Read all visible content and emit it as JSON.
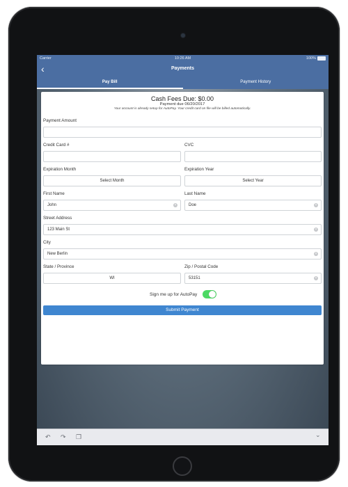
{
  "status_bar": {
    "carrier": "Carrier",
    "time": "10:26 AM",
    "battery": "100%"
  },
  "nav": {
    "title": "Payments",
    "back_icon": "‹"
  },
  "tabs": [
    {
      "label": "Pay Bill",
      "active": true
    },
    {
      "label": "Payment History",
      "active": false
    }
  ],
  "header": {
    "title": "Cash Fees Due: $0.00",
    "due": "Payment due 06/20/2017",
    "note": "Your account is already setup for AutoPay. Your credit card on file will be billed automatically."
  },
  "form": {
    "payment_amount": {
      "label": "Payment Amount",
      "value": ""
    },
    "credit_card": {
      "label": "Credit Card #",
      "value": ""
    },
    "cvc": {
      "label": "CVC",
      "value": ""
    },
    "exp_month": {
      "label": "Expiration Month",
      "value": "Select Month"
    },
    "exp_year": {
      "label": "Expiration Year",
      "value": "Select Year"
    },
    "first_name": {
      "label": "First Name",
      "value": "John"
    },
    "last_name": {
      "label": "Last Name",
      "value": "Doe"
    },
    "street": {
      "label": "Street Address",
      "value": "123 Main St"
    },
    "city": {
      "label": "City",
      "value": "New Berlin"
    },
    "state": {
      "label": "State / Province",
      "value": "WI"
    },
    "zip": {
      "label": "Zip / Postal Code",
      "value": "53151"
    },
    "autopay": {
      "label": "Sign me up for AutoPay",
      "enabled": true
    },
    "submit_label": "Submit Payment"
  },
  "toolbar": {
    "undo_icon": "↶",
    "redo_icon": "↷",
    "paste_icon": "❐",
    "chevron_icon": "⌄"
  },
  "colors": {
    "nav": "#4b6ea2",
    "button": "#3f86d0",
    "toggle": "#4cd964"
  }
}
